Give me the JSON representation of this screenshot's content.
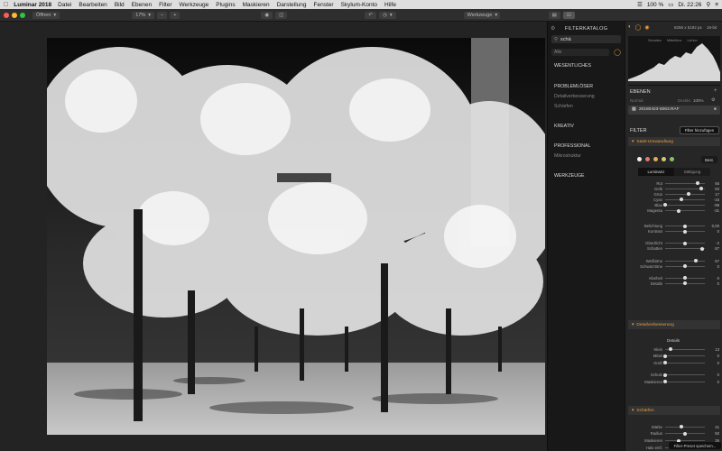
{
  "menubar": {
    "app": "Luminar 2018",
    "items": [
      "Datei",
      "Bearbeiten",
      "Bild",
      "Ebenen",
      "Filter",
      "Werkzeuge",
      "Plugins",
      "Maskieren",
      "Darstellung",
      "Fenster",
      "Skylum-Konto",
      "Hilfe"
    ],
    "battery": "100 %",
    "time": "Di. 22:26"
  },
  "toolbar": {
    "open_label": "Öffnen",
    "zoom": "17%",
    "workspace": "Werkzeuge"
  },
  "catalog": {
    "title": "FILTERKATALOG",
    "search_value": "schä",
    "filter_label": "Alle",
    "sections": [
      {
        "title": "WESENTLICHES",
        "items": []
      },
      {
        "title": "PROBLEMLÖSER",
        "items": [
          "Detailverbesserung",
          "Schärfen"
        ]
      },
      {
        "title": "KREATIV",
        "items": []
      },
      {
        "title": "PROFESSIONAL",
        "items": [
          "Mikrostruktur"
        ]
      },
      {
        "title": "WERKZEUGE",
        "items": []
      }
    ]
  },
  "right": {
    "image_info": "8256 x 6192 px",
    "bit_depth": "16-bit",
    "histogram_labels": [
      "Schatten",
      "Mitteltöne",
      "Lichter"
    ],
    "layers_title": "EBENEN",
    "layers_blend": "Normal",
    "layers_opacity_label": "Deckkr.",
    "layers_opacity": "100%",
    "layer_name": "20180423-5063.RAF",
    "filter_title": "FILTER",
    "add_filter": "Filter hinzufügen",
    "sw_section": "S&W-Umwandlung",
    "reset_label": "Best.",
    "tabs": [
      "Luminanz",
      "Sättigung"
    ],
    "sw_sliders": [
      {
        "label": "Rot",
        "value": "65",
        "pos": 0.82
      },
      {
        "label": "Gelb",
        "value": "83",
        "pos": 0.91
      },
      {
        "label": "Grün",
        "value": "17",
        "pos": 0.58
      },
      {
        "label": "Cyan",
        "value": "-15",
        "pos": 0.42
      },
      {
        "label": "Blau",
        "value": "-99",
        "pos": 0.01
      },
      {
        "label": "Magenta",
        "value": "-31",
        "pos": 0.35
      },
      {
        "label": "Belichtung",
        "value": "0,00",
        "pos": 0.5
      },
      {
        "label": "Kontrast",
        "value": "0",
        "pos": 0.5
      },
      {
        "label": "Glanzlicht",
        "value": "-2",
        "pos": 0.49
      },
      {
        "label": "Schatten",
        "value": "87",
        "pos": 0.93
      },
      {
        "label": "Weißtöne",
        "value": "57",
        "pos": 0.78
      },
      {
        "label": "Schwarztöne",
        "value": "0",
        "pos": 0.5
      },
      {
        "label": "Klarheit",
        "value": "0",
        "pos": 0.5
      },
      {
        "label": "Details",
        "value": "0",
        "pos": 0.5
      }
    ],
    "detail_section": "Detailverbesserung",
    "detail_group": "Details",
    "detail_sliders": [
      {
        "label": "Klein",
        "value": "13",
        "pos": 0.13
      },
      {
        "label": "Mittel",
        "value": "0",
        "pos": 0.0
      },
      {
        "label": "Groß",
        "value": "0",
        "pos": 0.0
      },
      {
        "label": "Schutz",
        "value": "0",
        "pos": 0.0
      },
      {
        "label": "Maskieren",
        "value": "0",
        "pos": 0.0
      }
    ],
    "sharpen_section": "Schärfen",
    "sharpen_sliders": [
      {
        "label": "Stärke",
        "value": "41",
        "pos": 0.41
      },
      {
        "label": "Radius",
        "value": "50",
        "pos": 0.5
      },
      {
        "label": "Maskieren",
        "value": "35",
        "pos": 0.35
      },
      {
        "label": "Halo entf.",
        "value": "50",
        "pos": 0.5
      }
    ],
    "save_preset": "Filter-Preset speichern..."
  },
  "colors": {
    "accent": "#e8a040",
    "panel": "#262626"
  }
}
